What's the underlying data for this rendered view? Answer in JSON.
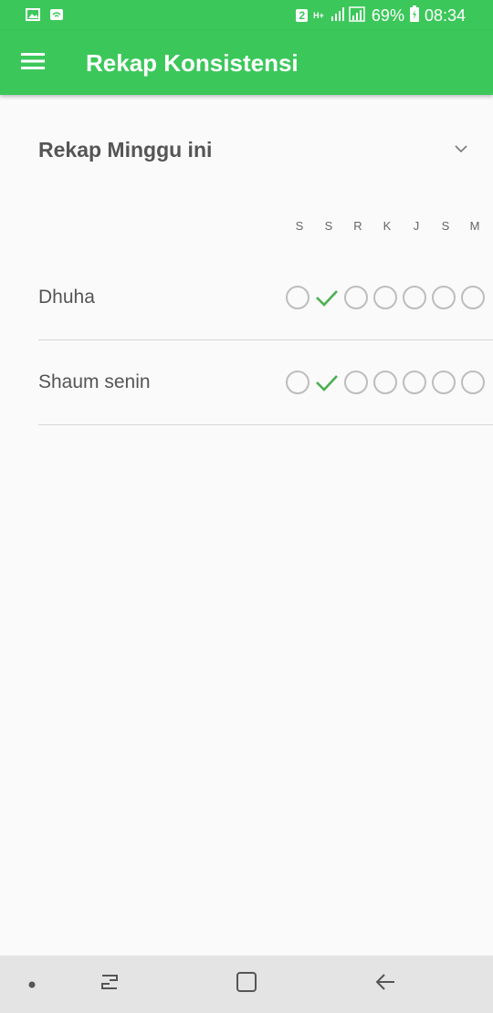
{
  "status_bar": {
    "sim_badge": "2",
    "network": "H+",
    "battery": "69%",
    "time": "08:34"
  },
  "app_bar": {
    "title": "Rekap Konsistensi",
    "menu_icon": "hamburger-menu-icon"
  },
  "section": {
    "title": "Rekap Minggu ini",
    "expand_icon": "chevron-down-icon"
  },
  "days": [
    "S",
    "S",
    "R",
    "K",
    "J",
    "S",
    "M"
  ],
  "habits": [
    {
      "name": "Dhuha",
      "week": [
        false,
        true,
        false,
        false,
        false,
        false,
        false
      ]
    },
    {
      "name": "Shaum senin",
      "week": [
        false,
        true,
        false,
        false,
        false,
        false,
        false
      ]
    }
  ],
  "colors": {
    "accent": "#3cc75b",
    "check": "#4caf50",
    "circle": "#bdbdbd"
  },
  "nav_bar": {
    "icons": [
      "dot-icon",
      "recent-apps-icon",
      "home-icon",
      "back-icon"
    ]
  }
}
